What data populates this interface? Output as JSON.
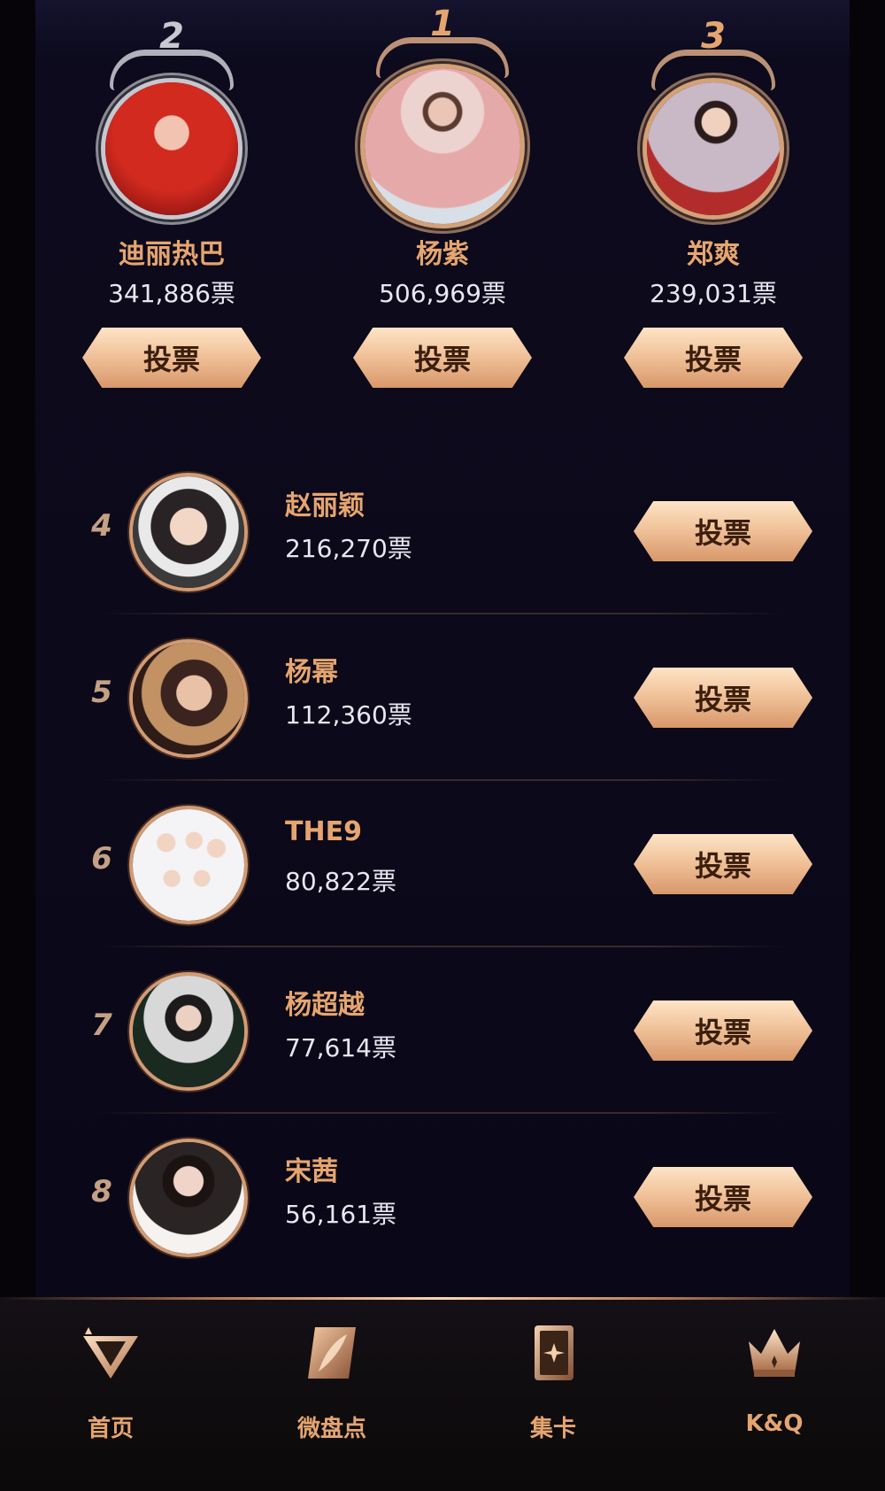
{
  "podium": [
    {
      "rank": "2",
      "name": "迪丽热巴",
      "votes": "341,886票",
      "button": "投票"
    },
    {
      "rank": "1",
      "name": "杨紫",
      "votes": "506,969票",
      "button": "投票"
    },
    {
      "rank": "3",
      "name": "郑爽",
      "votes": "239,031票",
      "button": "投票"
    }
  ],
  "list": [
    {
      "rank": "4",
      "name": "赵丽颖",
      "votes": "216,270票",
      "button": "投票"
    },
    {
      "rank": "5",
      "name": "杨幂",
      "votes": "112,360票",
      "button": "投票"
    },
    {
      "rank": "6",
      "name": "THE9",
      "votes": "80,822票",
      "button": "投票"
    },
    {
      "rank": "7",
      "name": "杨超越",
      "votes": "77,614票",
      "button": "投票"
    },
    {
      "rank": "8",
      "name": "宋茜",
      "votes": "56,161票",
      "button": "投票"
    }
  ],
  "tabs": [
    {
      "label": "首页",
      "icon": "home-triangle-icon"
    },
    {
      "label": "微盘点",
      "icon": "feather-card-icon"
    },
    {
      "label": "集卡",
      "icon": "card-collection-icon"
    },
    {
      "label": "K&Q",
      "icon": "crown-icon"
    }
  ],
  "colors": {
    "accent": "#e6a56f",
    "background": "#0a0818"
  }
}
